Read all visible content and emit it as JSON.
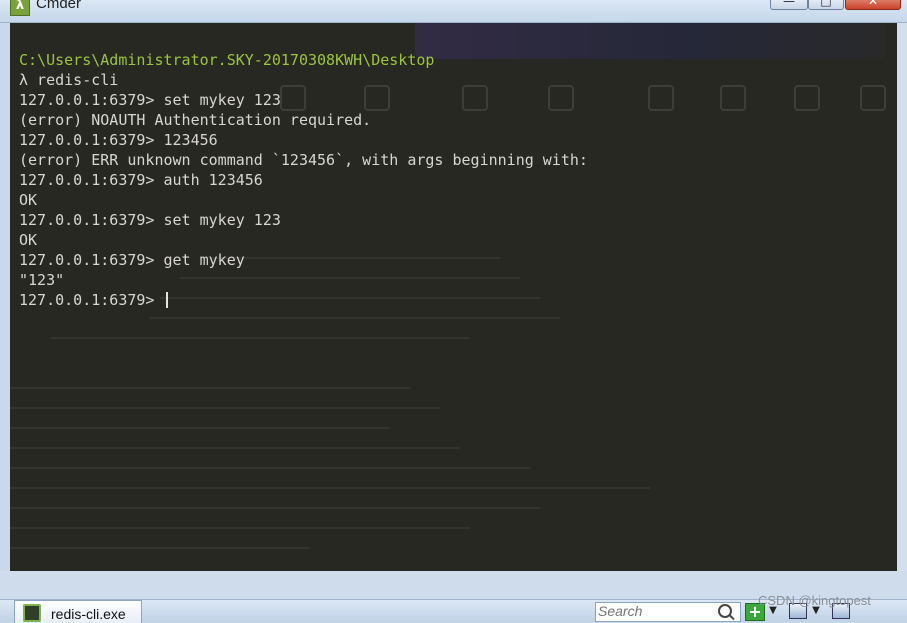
{
  "window": {
    "title": "Cmder",
    "app_icon_glyph": "λ",
    "minimize_glyph": "—",
    "maximize_glyph": "□",
    "close_glyph": "✕"
  },
  "terminal": {
    "lines": [
      {
        "text": "C:\\Users\\Administrator.SKY-20170308KWH\\Desktop",
        "kind": "path"
      },
      {
        "text": "λ redis-cli",
        "kind": "command"
      },
      {
        "text": "127.0.0.1:6379> set mykey 123",
        "kind": "command"
      },
      {
        "text": "(error) NOAUTH Authentication required.",
        "kind": "output"
      },
      {
        "text": "127.0.0.1:6379> 123456",
        "kind": "command"
      },
      {
        "text": "(error) ERR unknown command `123456`, with args beginning with:",
        "kind": "output"
      },
      {
        "text": "127.0.0.1:6379> auth 123456",
        "kind": "command"
      },
      {
        "text": "OK",
        "kind": "output"
      },
      {
        "text": "127.0.0.1:6379> set mykey 123",
        "kind": "command"
      },
      {
        "text": "OK",
        "kind": "output"
      },
      {
        "text": "127.0.0.1:6379> get mykey",
        "kind": "command"
      },
      {
        "text": "\"123\"",
        "kind": "output"
      },
      {
        "text": "127.0.0.1:6379> ",
        "kind": "prompt"
      }
    ],
    "colors": {
      "background": "#282822",
      "text": "#d7d7cf",
      "path": "#9bc53d"
    }
  },
  "taskbar": {
    "tab_label": "redis-cli.exe",
    "search_placeholder": "Search",
    "add_glyph": "+",
    "dropdown_glyph": "▼"
  },
  "watermark": "CSDN @kingtopest"
}
